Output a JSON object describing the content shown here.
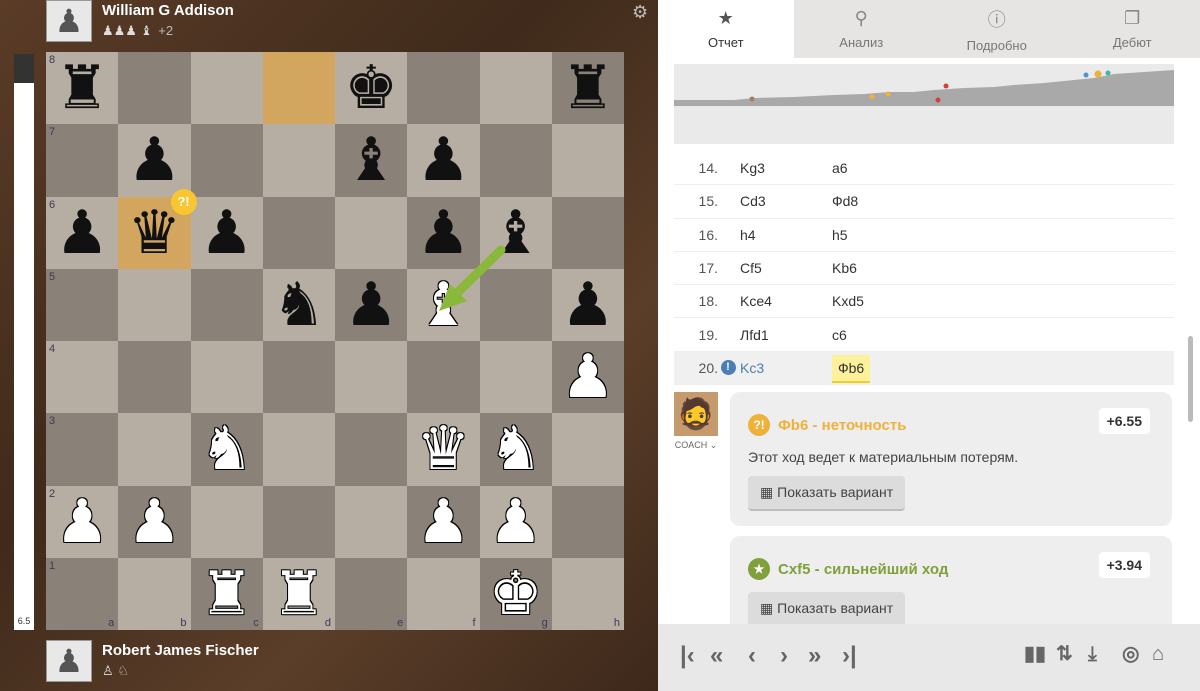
{
  "players": {
    "top": {
      "name": "William G Addison",
      "captured": "♟♟♟ ♝",
      "extra": "+2"
    },
    "bottom": {
      "name": "Robert James Fischer",
      "captured": "♙ ♘"
    }
  },
  "eval": {
    "value": "6.5",
    "fill_fraction": 0.95
  },
  "board": {
    "ranks": [
      "8",
      "7",
      "6",
      "5",
      "4",
      "3",
      "2",
      "1"
    ],
    "files": [
      "a",
      "b",
      "c",
      "d",
      "e",
      "f",
      "g",
      "h"
    ],
    "squares": [
      [
        "bR",
        "",
        "",
        "hl",
        "bK",
        "",
        "",
        "bR"
      ],
      [
        "",
        "bP",
        "",
        "",
        "bB",
        "bP",
        "",
        ""
      ],
      [
        "bP",
        "bQ!",
        "bP",
        "",
        "",
        "bP",
        "bB",
        ""
      ],
      [
        "",
        "",
        "",
        "bN",
        "bP",
        "wB",
        "",
        "bP"
      ],
      [
        "",
        "",
        "",
        "",
        "",
        "",
        "",
        "wP"
      ],
      [
        "",
        "",
        "wN",
        "",
        "",
        "wQ",
        "wN",
        ""
      ],
      [
        "wP",
        "wP",
        "",
        "",
        "",
        "wP",
        "wP",
        ""
      ],
      [
        "",
        "",
        "wR",
        "wR",
        "",
        "",
        "wK",
        ""
      ]
    ],
    "badge": "?!"
  },
  "tabs": [
    {
      "label": "Отчет",
      "icon": "star-icon"
    },
    {
      "label": "Анализ",
      "icon": "magnifier-icon"
    },
    {
      "label": "Подробно",
      "icon": "info-icon"
    },
    {
      "label": "Дебют",
      "icon": "book-icon"
    }
  ],
  "moves": [
    {
      "num": "14.",
      "white": "Kg3",
      "black": "a6"
    },
    {
      "num": "15.",
      "white": "Cd3",
      "black": "Фd8"
    },
    {
      "num": "16.",
      "white": "h4",
      "black": "h5"
    },
    {
      "num": "17.",
      "white": "Cf5",
      "black": "Kb6"
    },
    {
      "num": "18.",
      "white": "Kce4",
      "black": "Kxd5"
    },
    {
      "num": "19.",
      "white": "Лfd1",
      "black": "c6"
    },
    {
      "num": "20.",
      "white": "Kc3",
      "black": "Фb6"
    }
  ],
  "coach": {
    "label": "COACH ⌄"
  },
  "card1": {
    "icon": "?!",
    "title": "Фb6 - неточность",
    "score": "+6.55",
    "text": "Этот ход ведет к материальным потерям.",
    "button": "Показать вариант",
    "color": "#f0b13a"
  },
  "card2": {
    "icon": "★",
    "title": "Cxf5 - сильнейший ход",
    "score": "+3.94",
    "button": "Показать вариант",
    "color": "#7fa03b"
  },
  "controls": [
    "|<",
    "<<",
    "<",
    ">",
    ">>",
    ">|"
  ],
  "colors": {
    "light": "#b6aea3",
    "dark": "#8a8178",
    "highlight": "#e6c27a",
    "arrow": "#8ab83a"
  }
}
